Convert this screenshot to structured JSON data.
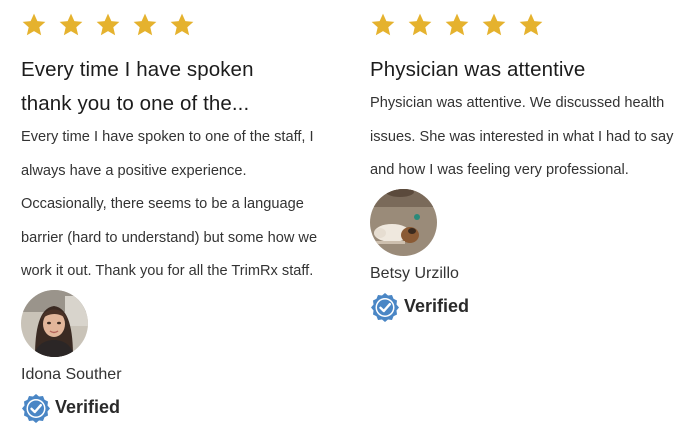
{
  "reviews": [
    {
      "rating": 5,
      "title_line1": "Every time I have spoken",
      "title_line2": "thank you to one of the...",
      "body_lines": [
        "Every time I have spoken to one of the staff, I",
        "always have a positive experience.",
        "Occasionally, there seems to be a language",
        "barrier (hard to understand) but some how we",
        "work it out. Thank you for all the TrimRx staff."
      ],
      "author": "Idona Souther",
      "verified_label": "Verified"
    },
    {
      "rating": 5,
      "title_line1": "Physician was attentive",
      "body_lines": [
        "Physician was attentive. We discussed health",
        "issues. She was interested in what I had to say",
        "and how I was feeling very professional."
      ],
      "author": "Betsy Urzillo",
      "verified_label": "Verified"
    }
  ],
  "colors": {
    "star": "#E5B22E",
    "badge": "#4A86C5",
    "text": "#333333"
  },
  "icons": {
    "star": "star-icon",
    "verified": "verified-badge-icon"
  }
}
